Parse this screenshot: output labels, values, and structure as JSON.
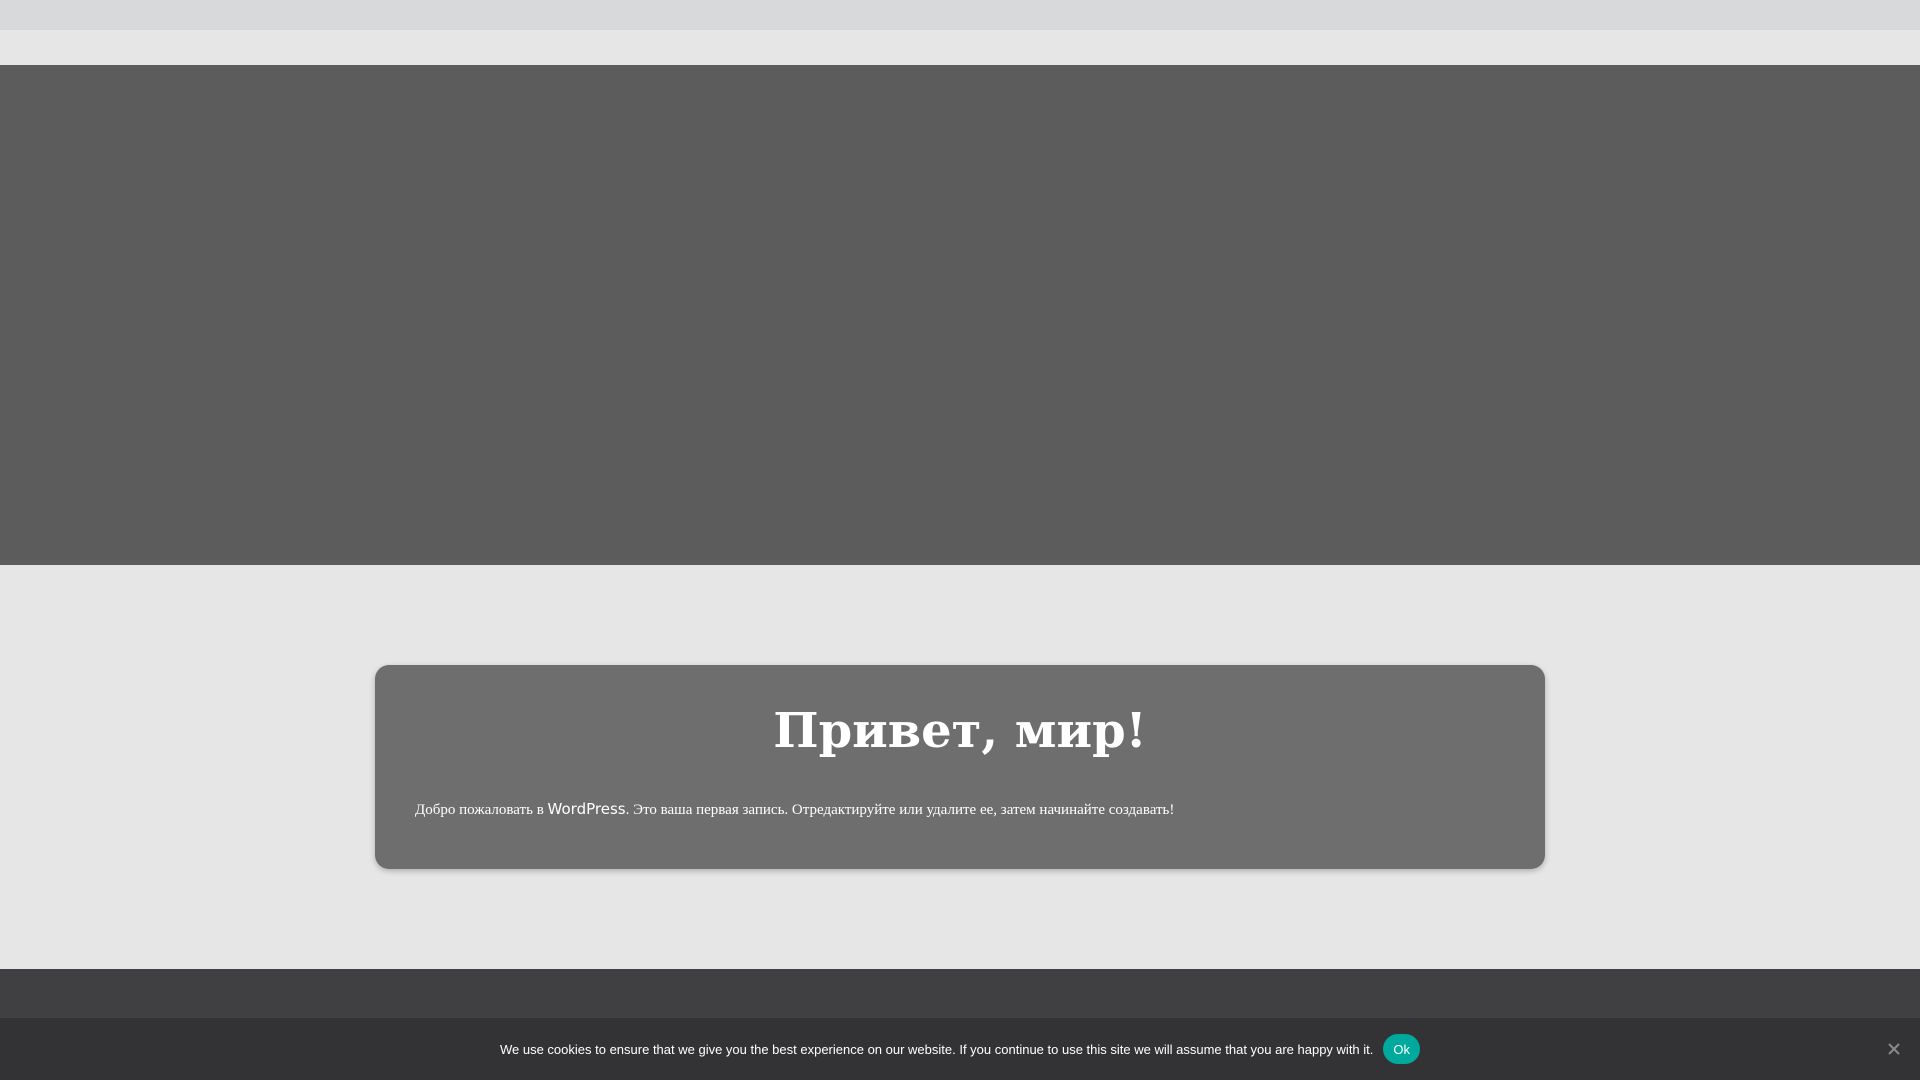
{
  "post": {
    "title": "Привет, мир!",
    "body_before": "Добро пожаловать в ",
    "body_link": "WordPress",
    "body_after": ". Это ваша первая запись. Отредактируйте или удалите ее, затем начинайте создавать!"
  },
  "cookie": {
    "message": "We use cookies to ensure that we give you the best experience on our website. If you continue to use this site we will assume that you are happy with it.",
    "ok_label": "Ok",
    "close_icon": "close-icon"
  },
  "colors": {
    "hero": "#5c5c5c",
    "card": "#6e6e6e",
    "cookie_button": "#00a99d",
    "footer": "#404042"
  }
}
